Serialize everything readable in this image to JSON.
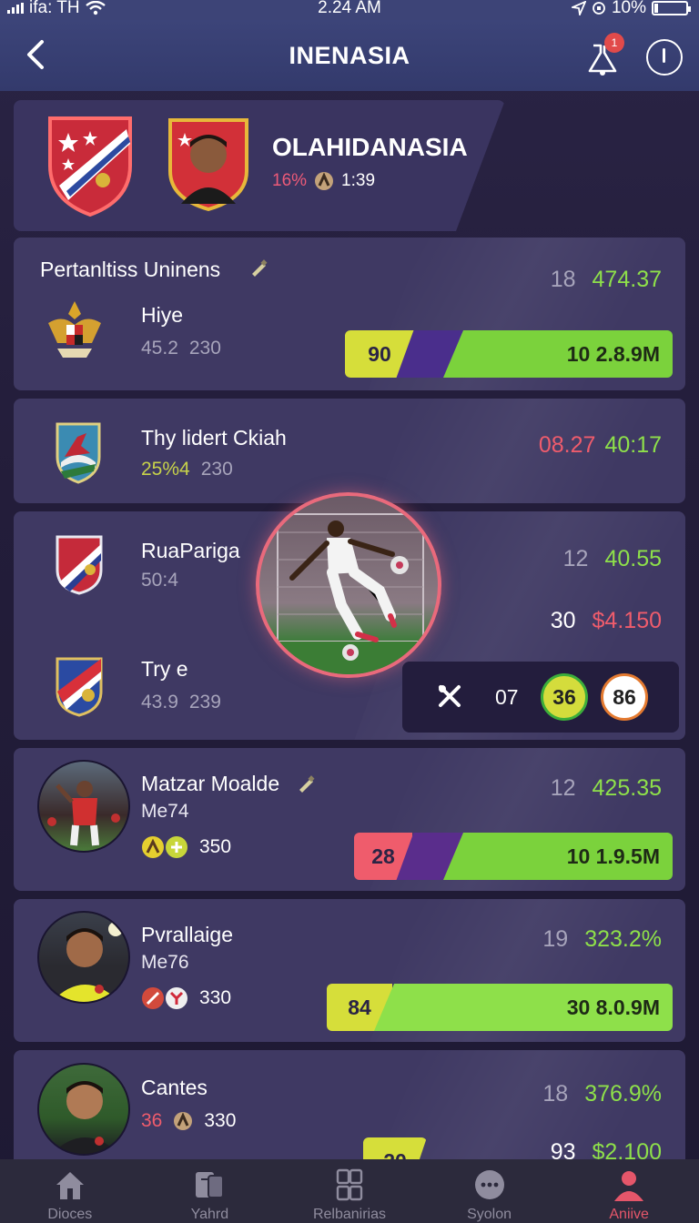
{
  "status": {
    "carrier": "ifa: TH",
    "time": "2.24 AM",
    "battery": "10%"
  },
  "header": {
    "title": "INENASIA",
    "notification_count": "1"
  },
  "team": {
    "name": "OLAHIDANASIA",
    "percent": "16%",
    "time": "1:39"
  },
  "rows": [
    {
      "section_title": "Pertanltiss Uninens",
      "name": "Hiye",
      "stat_a": "45.2",
      "stat_b": "230",
      "rank": "18",
      "value": "474.37",
      "bar_left": "90",
      "bar_right": "10 2.8.9M"
    },
    {
      "name": "Thy lidert Ckiah",
      "stat_a": "25%4",
      "stat_b": "230",
      "value_a": "08.27",
      "value_b": "40:17"
    },
    {
      "name": "RuaPariga",
      "stat_a": "50:4",
      "rank": "12",
      "value": "40.55",
      "sub_rank": "30",
      "sub_value": "$4.150"
    },
    {
      "name": "Try e",
      "stat_a": "43.9",
      "stat_b": "239",
      "match_num": "07",
      "score_a": "36",
      "score_b": "86"
    },
    {
      "name": "Matzar Moalde",
      "code": "Me74",
      "stat_b": "350",
      "rank": "12",
      "value": "425.35",
      "bar_left": "28",
      "bar_right": "10 1.9.5M"
    },
    {
      "name": "Pvrallaige",
      "code": "Me76",
      "stat_b": "330",
      "rank": "19",
      "value": "323.2%",
      "bar_left": "84",
      "bar_right": "30 8.0.9M"
    },
    {
      "name": "Cantes",
      "stat_a": "36",
      "stat_b": "330",
      "rank": "18",
      "value": "376.9%",
      "bar_left": "20",
      "sub_rank": "93",
      "sub_value": "$2.100"
    }
  ],
  "tabs": [
    {
      "label": "Dioces",
      "icon": "home-icon"
    },
    {
      "label": "Yahrd",
      "icon": "cards-icon"
    },
    {
      "label": "Relbanirias",
      "icon": "grid-icon"
    },
    {
      "label": "Syolon",
      "icon": "chat-icon"
    },
    {
      "label": "Aniive",
      "icon": "profile-icon",
      "active": true
    }
  ],
  "colors": {
    "accent_green": "#8ee04a",
    "accent_red": "#ef5c6c",
    "accent_yellow": "#d6de3a",
    "header_bg": "#3c4479"
  }
}
